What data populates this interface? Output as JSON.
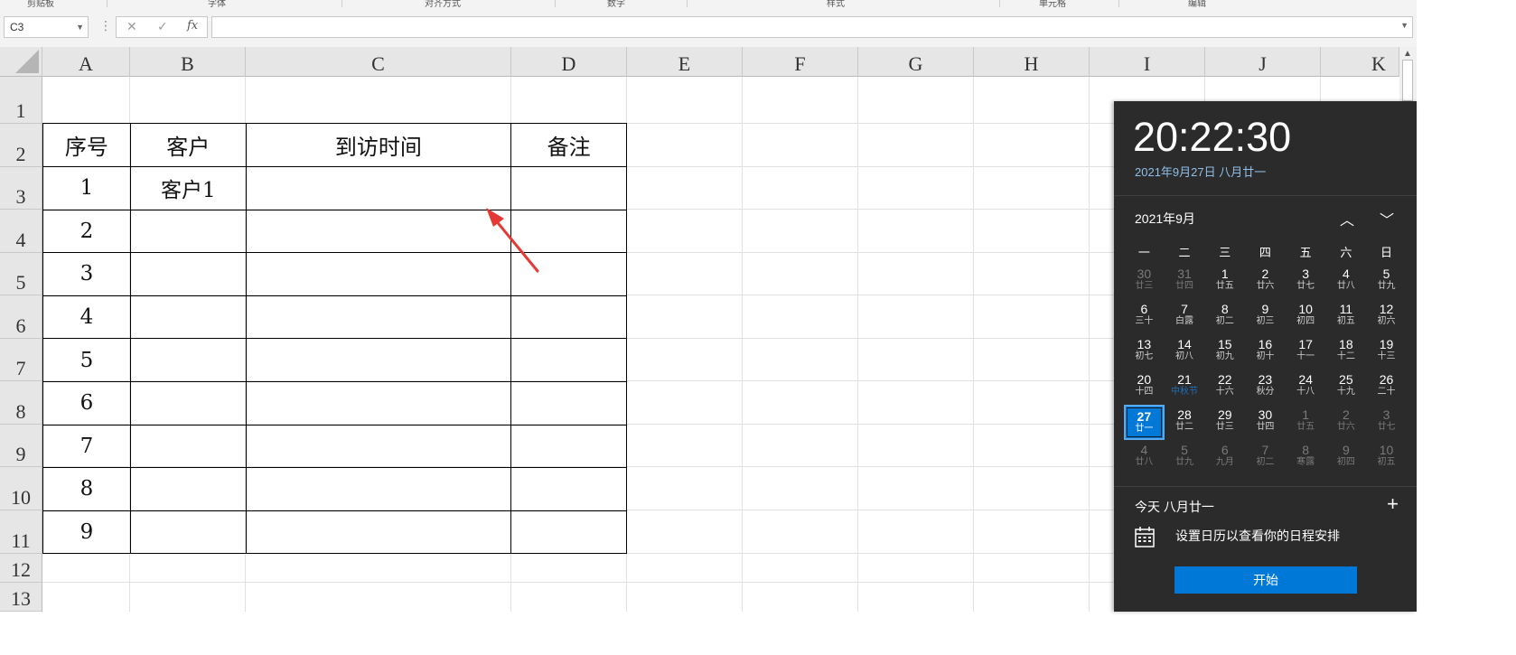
{
  "formula_bar": {
    "name_box": "C3",
    "cancel_icon": "✕",
    "enter_icon": "✓",
    "function_label": "fx",
    "formula_value": ""
  },
  "ribbon_groups": [
    "剪贴板",
    "字体",
    "对齐方式",
    "数字",
    "样式",
    "单元格",
    "编辑"
  ],
  "columns": [
    "A",
    "B",
    "C",
    "D",
    "E",
    "F",
    "G",
    "H",
    "I",
    "J",
    "K"
  ],
  "rows": [
    "1",
    "2",
    "3",
    "4",
    "5",
    "6",
    "7",
    "8",
    "9",
    "10",
    "11",
    "12",
    "13"
  ],
  "table": {
    "headers": [
      "序号",
      "客户",
      "到访时间",
      "备注"
    ],
    "rows": [
      [
        "1",
        "客户1",
        "",
        ""
      ],
      [
        "2",
        "",
        "",
        ""
      ],
      [
        "3",
        "",
        "",
        ""
      ],
      [
        "4",
        "",
        "",
        ""
      ],
      [
        "5",
        "",
        "",
        ""
      ],
      [
        "6",
        "",
        "",
        ""
      ],
      [
        "7",
        "",
        "",
        ""
      ],
      [
        "8",
        "",
        "",
        ""
      ],
      [
        "9",
        "",
        "",
        ""
      ]
    ]
  },
  "calendar": {
    "time": "20:22:30",
    "date": "2021年9月27日 八月廿一",
    "month_label": "2021年9月",
    "weekdays": [
      "一",
      "二",
      "三",
      "四",
      "五",
      "六",
      "日"
    ],
    "weeks": [
      [
        [
          "30",
          "廿三",
          "other"
        ],
        [
          "31",
          "廿四",
          "other"
        ],
        [
          "1",
          "廿五",
          "cur"
        ],
        [
          "2",
          "廿六",
          "cur"
        ],
        [
          "3",
          "廿七",
          "cur"
        ],
        [
          "4",
          "廿八",
          "cur"
        ],
        [
          "5",
          "廿九",
          "cur"
        ]
      ],
      [
        [
          "6",
          "三十",
          "cur"
        ],
        [
          "7",
          "白露",
          "cur"
        ],
        [
          "8",
          "初二",
          "cur"
        ],
        [
          "9",
          "初三",
          "cur"
        ],
        [
          "10",
          "初四",
          "cur"
        ],
        [
          "11",
          "初五",
          "cur"
        ],
        [
          "12",
          "初六",
          "cur"
        ]
      ],
      [
        [
          "13",
          "初七",
          "cur"
        ],
        [
          "14",
          "初八",
          "cur"
        ],
        [
          "15",
          "初九",
          "cur"
        ],
        [
          "16",
          "初十",
          "cur"
        ],
        [
          "17",
          "十一",
          "cur"
        ],
        [
          "18",
          "十二",
          "cur"
        ],
        [
          "19",
          "十三",
          "cur"
        ]
      ],
      [
        [
          "20",
          "十四",
          "cur"
        ],
        [
          "21",
          "中秋节",
          "holiday"
        ],
        [
          "22",
          "十六",
          "cur"
        ],
        [
          "23",
          "秋分",
          "cur"
        ],
        [
          "24",
          "十八",
          "cur"
        ],
        [
          "25",
          "十九",
          "cur"
        ],
        [
          "26",
          "二十",
          "cur"
        ]
      ],
      [
        [
          "27",
          "廿一",
          "today"
        ],
        [
          "28",
          "廿二",
          "cur"
        ],
        [
          "29",
          "廿三",
          "cur"
        ],
        [
          "30",
          "廿四",
          "cur"
        ],
        [
          "1",
          "廿五",
          "other"
        ],
        [
          "2",
          "廿六",
          "other"
        ],
        [
          "3",
          "廿七",
          "other"
        ]
      ],
      [
        [
          "4",
          "廿八",
          "other"
        ],
        [
          "5",
          "廿九",
          "other"
        ],
        [
          "6",
          "九月",
          "other"
        ],
        [
          "7",
          "初二",
          "other"
        ],
        [
          "8",
          "寒露",
          "other"
        ],
        [
          "9",
          "初四",
          "other"
        ],
        [
          "10",
          "初五",
          "other"
        ]
      ]
    ],
    "today_label": "今天 八月廿一",
    "add_icon": "+",
    "hint": "设置日历以查看你的日程安排",
    "start_button": "开始",
    "colors": {
      "accent": "#0078d7",
      "panel_bg": "#2b2b2b",
      "date_text": "#8fbfe8"
    }
  },
  "annotation_color": "#e53935"
}
